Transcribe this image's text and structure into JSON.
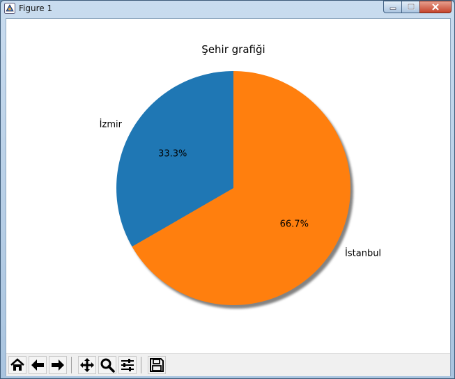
{
  "window": {
    "title": "Figure 1"
  },
  "toolbar": {
    "buttons": [
      {
        "name": "home-button",
        "icon": "home-icon"
      },
      {
        "name": "back-button",
        "icon": "arrow-left-icon"
      },
      {
        "name": "forward-button",
        "icon": "arrow-right-icon"
      },
      {
        "name": "pan-button",
        "icon": "move-icon"
      },
      {
        "name": "zoom-button",
        "icon": "magnifier-icon"
      },
      {
        "name": "configure-subplots-button",
        "icon": "sliders-icon"
      },
      {
        "name": "save-button",
        "icon": "floppy-disk-icon"
      }
    ]
  },
  "chart_data": {
    "type": "pie",
    "title": "Şehir grafiği",
    "labels": [
      "İzmir",
      "İstanbul"
    ],
    "values": [
      1,
      2
    ],
    "autopct": [
      "33.3%",
      "66.7%"
    ],
    "colors": [
      "#1f77b4",
      "#ff7f0e"
    ],
    "shadow": true,
    "startangle": 90
  }
}
